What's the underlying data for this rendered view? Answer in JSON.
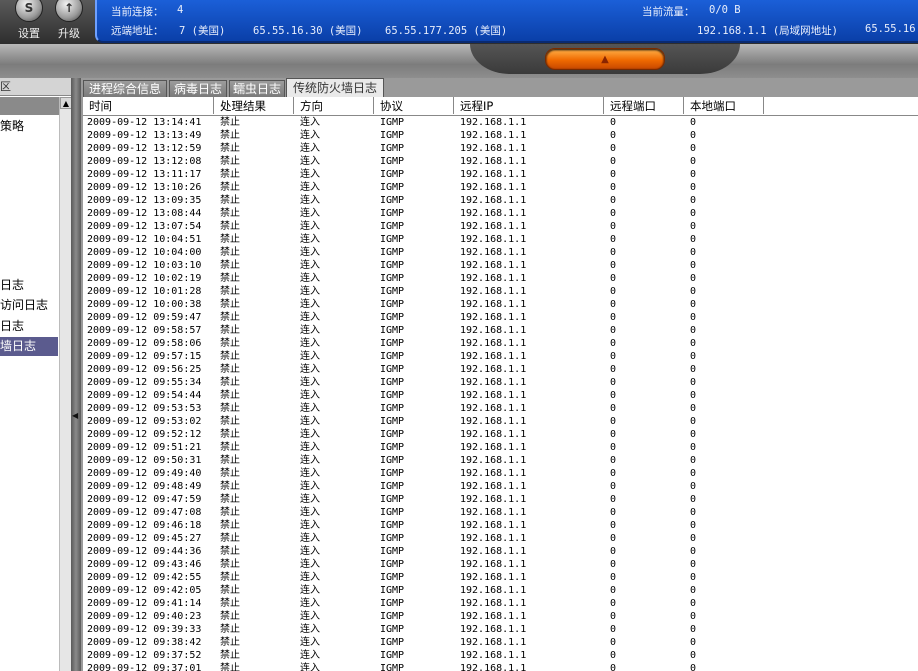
{
  "toolbar": {
    "settings_label": "设置",
    "upgrade_label": "升级",
    "partial_left_label": "|"
  },
  "status": {
    "connections_label": "当前连接：",
    "connections_value": "4",
    "traffic_label": "当前流量：",
    "traffic_value": "0/0 B",
    "remote_label": "远端地址：",
    "remote_count": "7 (美国)",
    "ip1": "65.55.16.30 (美国)",
    "ip2": "65.55.177.205 (美国)",
    "local_ip": "192.168.1.1 (局域网地址)",
    "ip3": "65.55.16"
  },
  "left": {
    "header": "区",
    "items": [
      {
        "label": "策略",
        "selected": false
      },
      {
        "label": "日志",
        "selected": false
      },
      {
        "label": "访问日志",
        "selected": false
      },
      {
        "label": "日志",
        "selected": false
      },
      {
        "label": "墙日志",
        "selected": true
      }
    ]
  },
  "tabs": [
    "进程综合信息",
    "病毒日志",
    "蠕虫日志",
    "传统防火墙日志"
  ],
  "columns": [
    "时间",
    "处理结果",
    "方向",
    "协议",
    "远程IP",
    "远程端口",
    "本地端口"
  ],
  "row_defaults": {
    "result": "禁止",
    "direction": "连入",
    "protocol": "IGMP",
    "remote_ip": "192.168.1.1",
    "remote_port": "0",
    "local_port": "0"
  },
  "rows": [
    "2009-09-12 13:14:41",
    "2009-09-12 13:13:49",
    "2009-09-12 13:12:59",
    "2009-09-12 13:12:08",
    "2009-09-12 13:11:17",
    "2009-09-12 13:10:26",
    "2009-09-12 13:09:35",
    "2009-09-12 13:08:44",
    "2009-09-12 13:07:54",
    "2009-09-12 10:04:51",
    "2009-09-12 10:04:00",
    "2009-09-12 10:03:10",
    "2009-09-12 10:02:19",
    "2009-09-12 10:01:28",
    "2009-09-12 10:00:38",
    "2009-09-12 09:59:47",
    "2009-09-12 09:58:57",
    "2009-09-12 09:58:06",
    "2009-09-12 09:57:15",
    "2009-09-12 09:56:25",
    "2009-09-12 09:55:34",
    "2009-09-12 09:54:44",
    "2009-09-12 09:53:53",
    "2009-09-12 09:53:02",
    "2009-09-12 09:52:12",
    "2009-09-12 09:51:21",
    "2009-09-12 09:50:31",
    "2009-09-12 09:49:40",
    "2009-09-12 09:48:49",
    "2009-09-12 09:47:59",
    "2009-09-12 09:47:08",
    "2009-09-12 09:46:18",
    "2009-09-12 09:45:27",
    "2009-09-12 09:44:36",
    "2009-09-12 09:43:46",
    "2009-09-12 09:42:55",
    "2009-09-12 09:42:05",
    "2009-09-12 09:41:14",
    "2009-09-12 09:40:23",
    "2009-09-12 09:39:33",
    "2009-09-12 09:38:42",
    "2009-09-12 09:37:52",
    "2009-09-12 09:37:01"
  ],
  "icons": {
    "settings": "settings-icon",
    "upgrade": "upgrade-icon",
    "toggle": "arrow-up-icon",
    "scroll_up": "scroll-up-icon",
    "splitter": "collapse-left-icon"
  },
  "colors": {
    "status_blue": "#0a3fa8",
    "toggle_orange": "#f06a00",
    "selected_item": "#5b5b8e"
  }
}
